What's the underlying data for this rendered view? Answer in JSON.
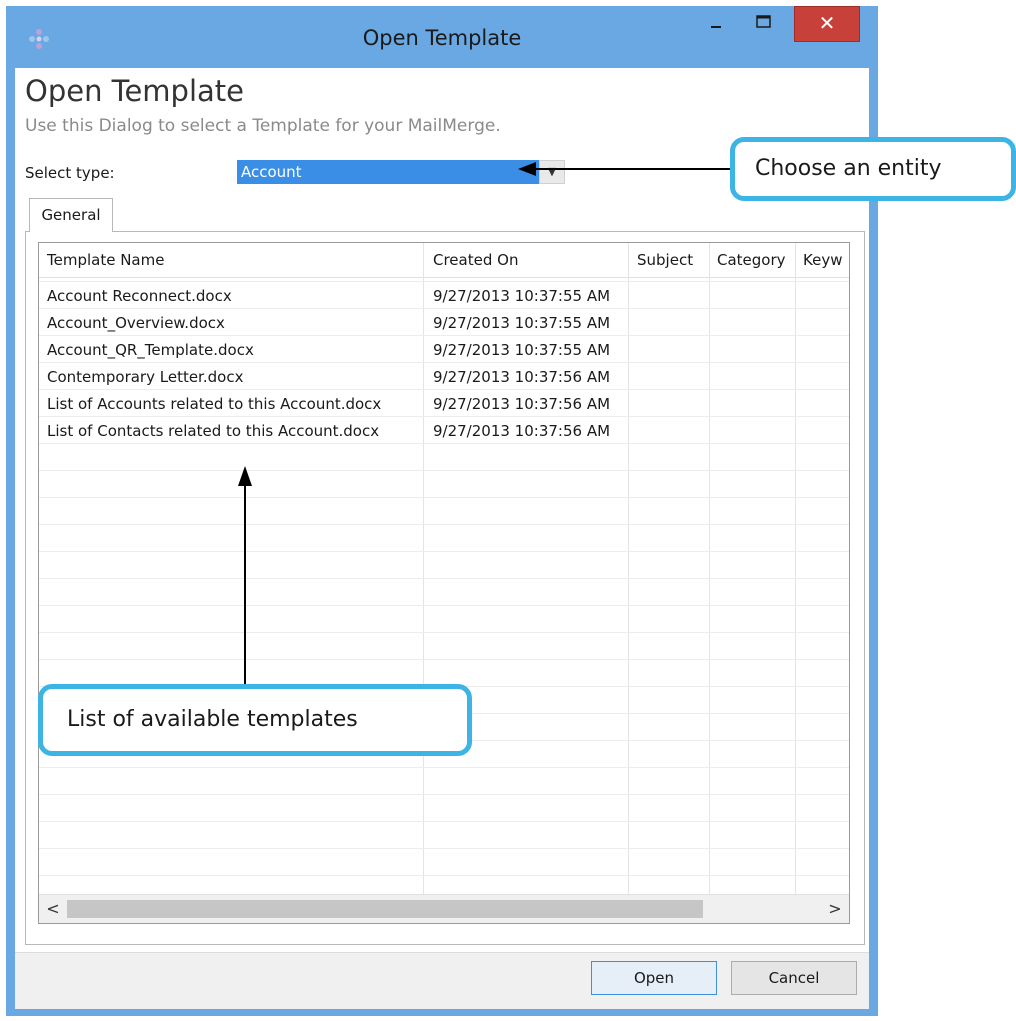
{
  "window": {
    "title": "Open Template",
    "minimize_glyph": "–",
    "maximize_glyph": "□",
    "close_glyph": "✕"
  },
  "header": {
    "title": "Open Template",
    "subtitle": "Use this Dialog to select a Template for your MailMerge."
  },
  "type_selector": {
    "label": "Select type:",
    "value": "Account",
    "dropdown_glyph": "▼"
  },
  "tabs": [
    {
      "label": "General",
      "active": true
    }
  ],
  "grid": {
    "columns": [
      "Template Name",
      "Created On",
      "Subject",
      "Category",
      "Keyw"
    ],
    "rows": [
      [
        "Account Reconnect.docx",
        "9/27/2013 10:37:55 AM",
        "",
        "",
        ""
      ],
      [
        "Account_Overview.docx",
        "9/27/2013 10:37:55 AM",
        "",
        "",
        ""
      ],
      [
        "Account_QR_Template.docx",
        "9/27/2013 10:37:55 AM",
        "",
        "",
        ""
      ],
      [
        "Contemporary Letter.docx",
        "9/27/2013 10:37:56 AM",
        "",
        "",
        ""
      ],
      [
        "List of Accounts related to this Account.docx",
        "9/27/2013 10:37:56 AM",
        "",
        "",
        ""
      ],
      [
        "List of Contacts related to this Account.docx",
        "9/27/2013 10:37:56 AM",
        "",
        "",
        ""
      ]
    ],
    "scroll_left_glyph": "<",
    "scroll_right_glyph": ">"
  },
  "footer": {
    "open_label": "Open",
    "cancel_label": "Cancel"
  },
  "annotations": {
    "entity_callout": "Choose an entity",
    "list_callout": "List of available templates"
  },
  "colors": {
    "titlebar": "#6aa8e4",
    "close_button": "#c7403a",
    "selection": "#3a8ee6",
    "callout_border": "#3cb4e6"
  }
}
